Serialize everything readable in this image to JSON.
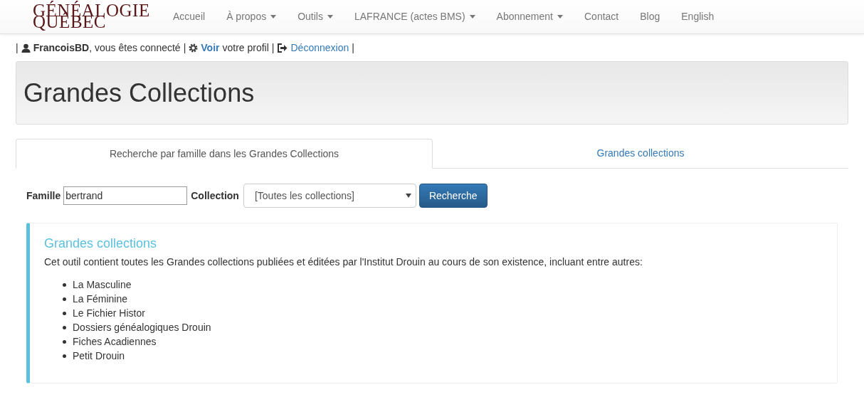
{
  "logo": {
    "line_1": "GÉNÉALOGIE",
    "line_2": "QUÉBEC"
  },
  "nav": [
    {
      "label": "Accueil",
      "dropdown": false
    },
    {
      "label": "À propos",
      "dropdown": true
    },
    {
      "label": "Outils",
      "dropdown": true
    },
    {
      "label": "LAFRANCE (actes BMS)",
      "dropdown": true
    },
    {
      "label": "Abonnement",
      "dropdown": true
    },
    {
      "label": "Contact",
      "dropdown": false
    },
    {
      "label": "Blog",
      "dropdown": false
    },
    {
      "label": "English",
      "dropdown": false
    }
  ],
  "user_bar": {
    "sep": "|",
    "user": "FrancoisBD",
    "connected": ", vous êtes connecté",
    "view_link": "Voir",
    "view_rest": "votre profil",
    "logout": "Déconnexion"
  },
  "page_title": "Grandes Collections",
  "tabs": [
    {
      "label": "Recherche par famille dans les Grandes Collections",
      "selected": true
    },
    {
      "label": "Grandes collections",
      "selected": false
    }
  ],
  "search": {
    "family_label": "Famille",
    "family_value": "bertrand",
    "collection_label": "Collection",
    "collection_value": "[Toutes les collections]",
    "button": "Recherche"
  },
  "info": {
    "title": "Grandes collections",
    "text": "Cet outil contient toutes les Grandes collections publiées et éditées par l'Institut Drouin au cours de son existence, incluant entre autres:",
    "items": [
      "La Masculine",
      "La Féminine",
      "Le Fichier Histor",
      "Dossiers généalogiques Drouin",
      "Fiches Acadiennes",
      "Petit Drouin"
    ]
  }
}
